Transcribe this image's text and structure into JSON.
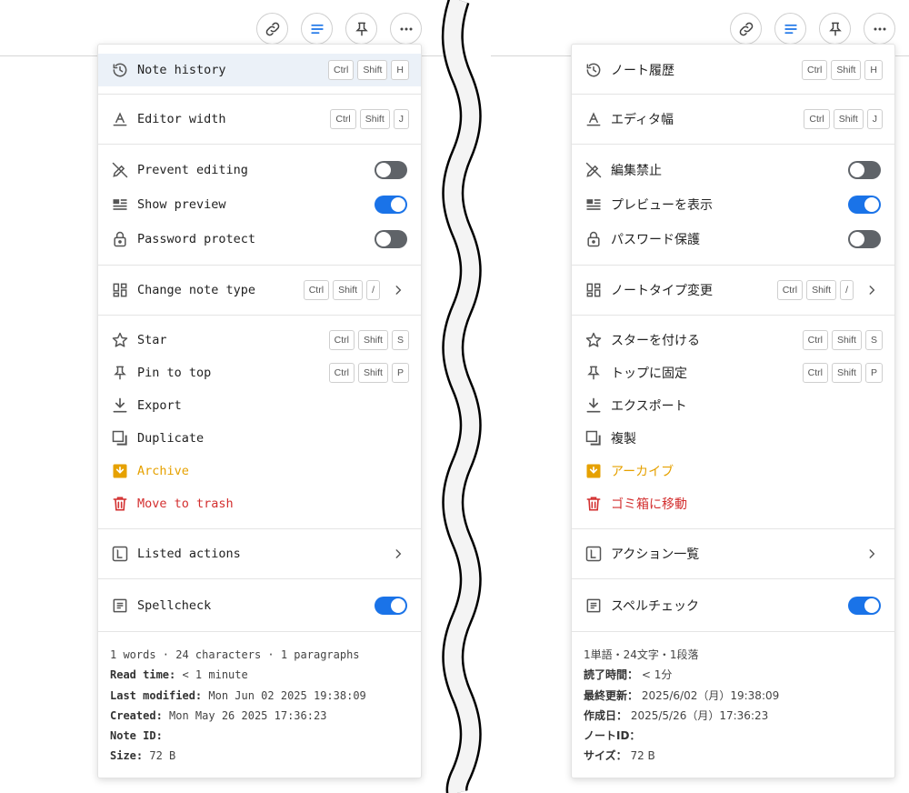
{
  "toolbar": {
    "link_button": "link-icon",
    "format_button": "format-icon",
    "pin_button": "pin-icon",
    "more_button": "more-icon"
  },
  "colors": {
    "accent": "#1a73e8",
    "archive": "#e6a100",
    "trash": "#d32f2f",
    "toggle_off": "#5f6368"
  },
  "en": {
    "note_history": {
      "label": "Note history",
      "keys": [
        "Ctrl",
        "Shift",
        "H"
      ]
    },
    "editor_width": {
      "label": "Editor width",
      "keys": [
        "Ctrl",
        "Shift",
        "J"
      ]
    },
    "prevent_editing": {
      "label": "Prevent editing",
      "on": false
    },
    "show_preview": {
      "label": "Show preview",
      "on": true
    },
    "password_protect": {
      "label": "Password protect",
      "on": false
    },
    "change_note_type": {
      "label": "Change note type",
      "keys": [
        "Ctrl",
        "Shift",
        "/"
      ]
    },
    "star": {
      "label": "Star",
      "keys": [
        "Ctrl",
        "Shift",
        "S"
      ]
    },
    "pin_to_top": {
      "label": "Pin to top",
      "keys": [
        "Ctrl",
        "Shift",
        "P"
      ]
    },
    "export": {
      "label": "Export"
    },
    "duplicate": {
      "label": "Duplicate"
    },
    "archive": {
      "label": "Archive"
    },
    "move_to_trash": {
      "label": "Move to trash"
    },
    "listed_actions": {
      "label": "Listed actions"
    },
    "spellcheck": {
      "label": "Spellcheck",
      "on": true
    },
    "footer": {
      "stats": "1 words · 24 characters · 1 paragraphs",
      "read_time_label": "Read time:",
      "read_time_value": " < 1 minute",
      "last_modified_label": "Last modified:",
      "last_modified_value": " Mon Jun 02 2025 19:38:09",
      "created_label": "Created:",
      "created_value": " Mon May 26 2025 17:36:23",
      "note_id_label": "Note ID:",
      "size_label": "Size:",
      "size_value": " 72 B"
    }
  },
  "ja": {
    "note_history": {
      "label": "ノート履歴",
      "keys": [
        "Ctrl",
        "Shift",
        "H"
      ]
    },
    "editor_width": {
      "label": "エディタ幅",
      "keys": [
        "Ctrl",
        "Shift",
        "J"
      ]
    },
    "prevent_editing": {
      "label": "編集禁止",
      "on": false
    },
    "show_preview": {
      "label": "プレビューを表示",
      "on": true
    },
    "password_protect": {
      "label": "パスワード保護",
      "on": false
    },
    "change_note_type": {
      "label": "ノートタイプ変更",
      "keys": [
        "Ctrl",
        "Shift",
        "/"
      ]
    },
    "star": {
      "label": "スターを付ける",
      "keys": [
        "Ctrl",
        "Shift",
        "S"
      ]
    },
    "pin_to_top": {
      "label": "トップに固定",
      "keys": [
        "Ctrl",
        "Shift",
        "P"
      ]
    },
    "export": {
      "label": "エクスポート"
    },
    "duplicate": {
      "label": "複製"
    },
    "archive": {
      "label": "アーカイブ"
    },
    "move_to_trash": {
      "label": "ゴミ箱に移動"
    },
    "listed_actions": {
      "label": "アクション一覧"
    },
    "spellcheck": {
      "label": "スペルチェック",
      "on": true
    },
    "footer": {
      "stats": "1単語・24文字・1段落",
      "read_time_label": "読了時間：",
      "read_time_value": " < 1分",
      "last_modified_label": "最終更新：",
      "last_modified_value": " 2025/6/02（月）19:38:09",
      "created_label": "作成日：",
      "created_value": " 2025/5/26（月）17:36:23",
      "note_id_label": "ノートID：",
      "size_label": "サイズ：",
      "size_value": " 72 B"
    }
  }
}
